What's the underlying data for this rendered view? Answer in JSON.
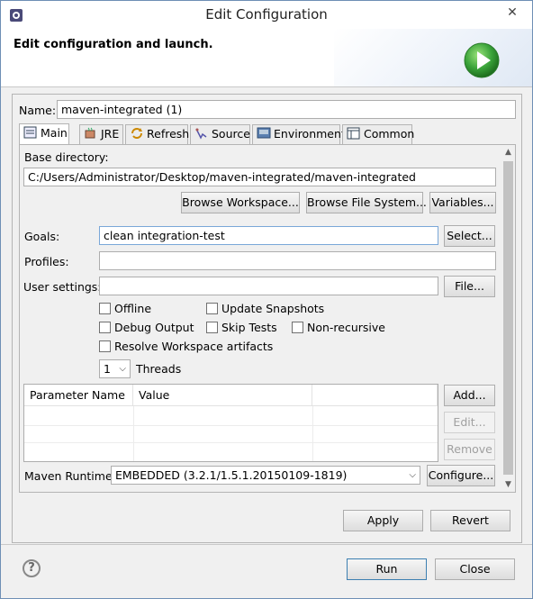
{
  "window": {
    "title": "Edit Configuration",
    "close_glyph": "✕"
  },
  "banner": {
    "heading": "Edit configuration and launch.",
    "icon": "run-play-icon"
  },
  "name_label": "Name:",
  "name_value": "maven-integrated (1)",
  "tabs": [
    {
      "label": "Main",
      "icon": "main-tab-icon",
      "selected": true
    },
    {
      "label": "JRE",
      "icon": "jre-icon",
      "selected": false
    },
    {
      "label": "Refresh",
      "icon": "refresh-icon",
      "selected": false
    },
    {
      "label": "Source",
      "icon": "source-icon",
      "selected": false
    },
    {
      "label": "Environment",
      "icon": "environment-icon",
      "selected": false
    },
    {
      "label": "Common",
      "icon": "common-icon",
      "selected": false
    }
  ],
  "main": {
    "base_directory_label": "Base directory:",
    "base_directory_value": "C:/Users/Administrator/Desktop/maven-integrated/maven-integrated",
    "browse_workspace": "Browse Workspace...",
    "browse_file_system": "Browse File System...",
    "variables": "Variables...",
    "goals_label": "Goals:",
    "goals_value": "clean integration-test",
    "select_button": "Select...",
    "profiles_label": "Profiles:",
    "profiles_value": "",
    "user_settings_label": "User settings:",
    "user_settings_value": "",
    "file_button": "File...",
    "checkboxes": {
      "offline": "Offline",
      "update_snapshots": "Update Snapshots",
      "debug_output": "Debug Output",
      "skip_tests": "Skip Tests",
      "non_recursive": "Non-recursive",
      "resolve_workspace": "Resolve Workspace artifacts"
    },
    "threads_value": "1",
    "threads_label": "Threads",
    "table": {
      "col_name": "Parameter Name",
      "col_value": "Value"
    },
    "add_button": "Add...",
    "edit_button": "Edit...",
    "remove_button": "Remove",
    "runtime_label": "Maven Runtime:",
    "runtime_value": "EMBEDDED (3.2.1/1.5.1.20150109-1819)",
    "configure_button": "Configure..."
  },
  "apply_button": "Apply",
  "revert_button": "Revert",
  "run_button": "Run",
  "close_button": "Close",
  "help_glyph": "?"
}
